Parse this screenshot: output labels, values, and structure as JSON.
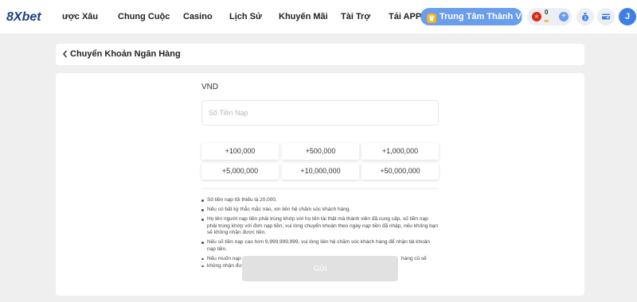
{
  "header": {
    "logo_text": "8Xbet",
    "nav": [
      {
        "label": "ược Xâu"
      },
      {
        "label": "Chung Cuộc"
      },
      {
        "label": "Casino"
      },
      {
        "label": "Lịch Sử"
      },
      {
        "label": "Khuyến Mãi"
      },
      {
        "label": "Tài Trợ"
      },
      {
        "label": "Tải APP"
      }
    ],
    "vip_button_label": "Trung Tâm Thành Viên",
    "balance": {
      "value": "0",
      "currency_flag": "vietnam-flag-icon"
    },
    "avatar_initial": "J",
    "icons": [
      "crown-icon",
      "plus-icon",
      "deposit-bag-icon",
      "wallet-card-icon"
    ]
  },
  "page": {
    "title": "Chuyển Khoản Ngân Hàng"
  },
  "form": {
    "currency": "VND",
    "amount_placeholder": "Số Tiền Nạp",
    "amount_value": "",
    "quick_amounts": [
      "+100,000",
      "+500,000",
      "+1,000,000",
      "+5,000,000",
      "+10,000,000",
      "+50,000,000"
    ],
    "notes": [
      "Số tiền nạp tối thiểu là 20,000.",
      "Nếu có bất kỳ thắc mắc nào, xin liên hệ chăm sóc khách hàng.",
      "Họ tên người nạp tiền phải trùng khớp với họ tên tài thật mà thành viên đã cung cấp, số tiền nạp phải trùng khớp với đơn nạp tiền, vui lòng chuyển khoản theo ngày nạp tiền đã nhập, nếu không bạn sẽ không nhận được tiền.",
      "Nếu số tiền nạp cao hơn 9,999,999,999, vui lòng liên hệ chăm sóc khách hàng để nhận tài khoản nạp tiền.",
      "Nếu muốn nạp",
      "hàng cũ sẽ",
      "không nhận đư"
    ],
    "submit_label": "Gửi"
  },
  "colors": {
    "accent_blue": "#6a9dea",
    "submit_disabled": "#e1e1e1",
    "page_bg": "#efefef"
  }
}
